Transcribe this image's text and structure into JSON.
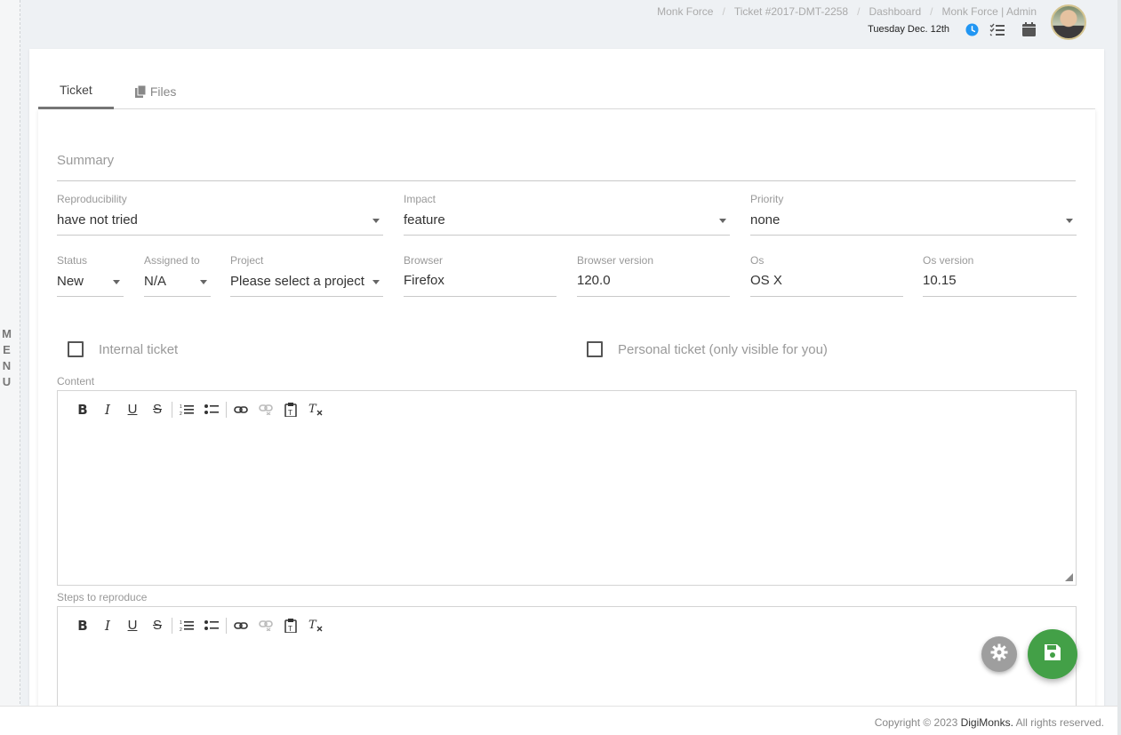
{
  "sidemenu": {
    "label": "MENU"
  },
  "breadcrumb": [
    "Monk Force",
    "Ticket #2017-DMT-2258",
    "Dashboard",
    "Monk Force | Admin"
  ],
  "header": {
    "date": "Tuesday Dec. 12th",
    "icons": [
      "clock-icon",
      "tasks-icon",
      "calendar-icon"
    ],
    "accent": "#2196f3"
  },
  "tabs": [
    {
      "label": "Ticket",
      "active": true
    },
    {
      "label": "Files",
      "icon": "copy-icon",
      "active": false
    }
  ],
  "form": {
    "summary_placeholder": "Summary",
    "reproducibility": {
      "label": "Reproducibility",
      "value": "have not tried"
    },
    "impact": {
      "label": "Impact",
      "value": "feature"
    },
    "priority": {
      "label": "Priority",
      "value": "none"
    },
    "status": {
      "label": "Status",
      "value": "New"
    },
    "assigned": {
      "label": "Assigned to",
      "value": "N/A"
    },
    "project": {
      "label": "Project",
      "value": "Please select a project"
    },
    "browser": {
      "label": "Browser",
      "value": "Firefox"
    },
    "browser_version": {
      "label": "Browser version",
      "value": "120.0"
    },
    "os": {
      "label": "Os",
      "value": "OS X"
    },
    "os_version": {
      "label": "Os version",
      "value": "10.15"
    },
    "internal_ticket": {
      "label": "Internal ticket",
      "checked": false
    },
    "personal_ticket": {
      "label": "Personal ticket (only visible for you)",
      "checked": false
    },
    "content_label": "Content",
    "steps_label": "Steps to reproduce"
  },
  "toolbar_tools": [
    "B",
    "I",
    "U",
    "S"
  ],
  "fab": {
    "save_color": "#43a047",
    "gear_color": "#9e9e9e"
  },
  "footer": {
    "prefix": "Copyright © 2023",
    "brand": "DigiMonks.",
    "suffix": "All rights reserved."
  }
}
